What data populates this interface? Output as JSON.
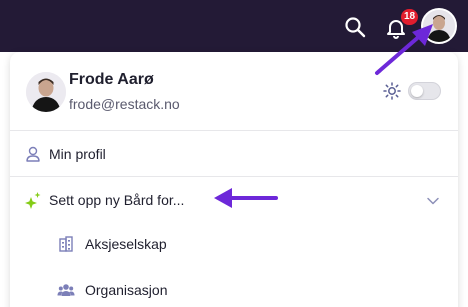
{
  "topbar": {
    "notification_count": "18",
    "icons": [
      "search-icon",
      "bell-icon",
      "avatar"
    ]
  },
  "user": {
    "name": "Frode Aarø",
    "email": "frode@restack.no"
  },
  "theme": {
    "icon": "sun-icon",
    "dark_mode": false
  },
  "menu": {
    "profile_label": "Min profil",
    "setup_label": "Sett opp ny Bård for...",
    "sub_items": [
      "Aksjeselskap",
      "Organisasjon"
    ]
  },
  "colors": {
    "topbar_bg": "#231a36",
    "accent_purple": "#6d28d9",
    "sparkle_green": "#84cc16",
    "icon_purple": "#7c7fb8",
    "badge_red": "#e11d2e"
  }
}
